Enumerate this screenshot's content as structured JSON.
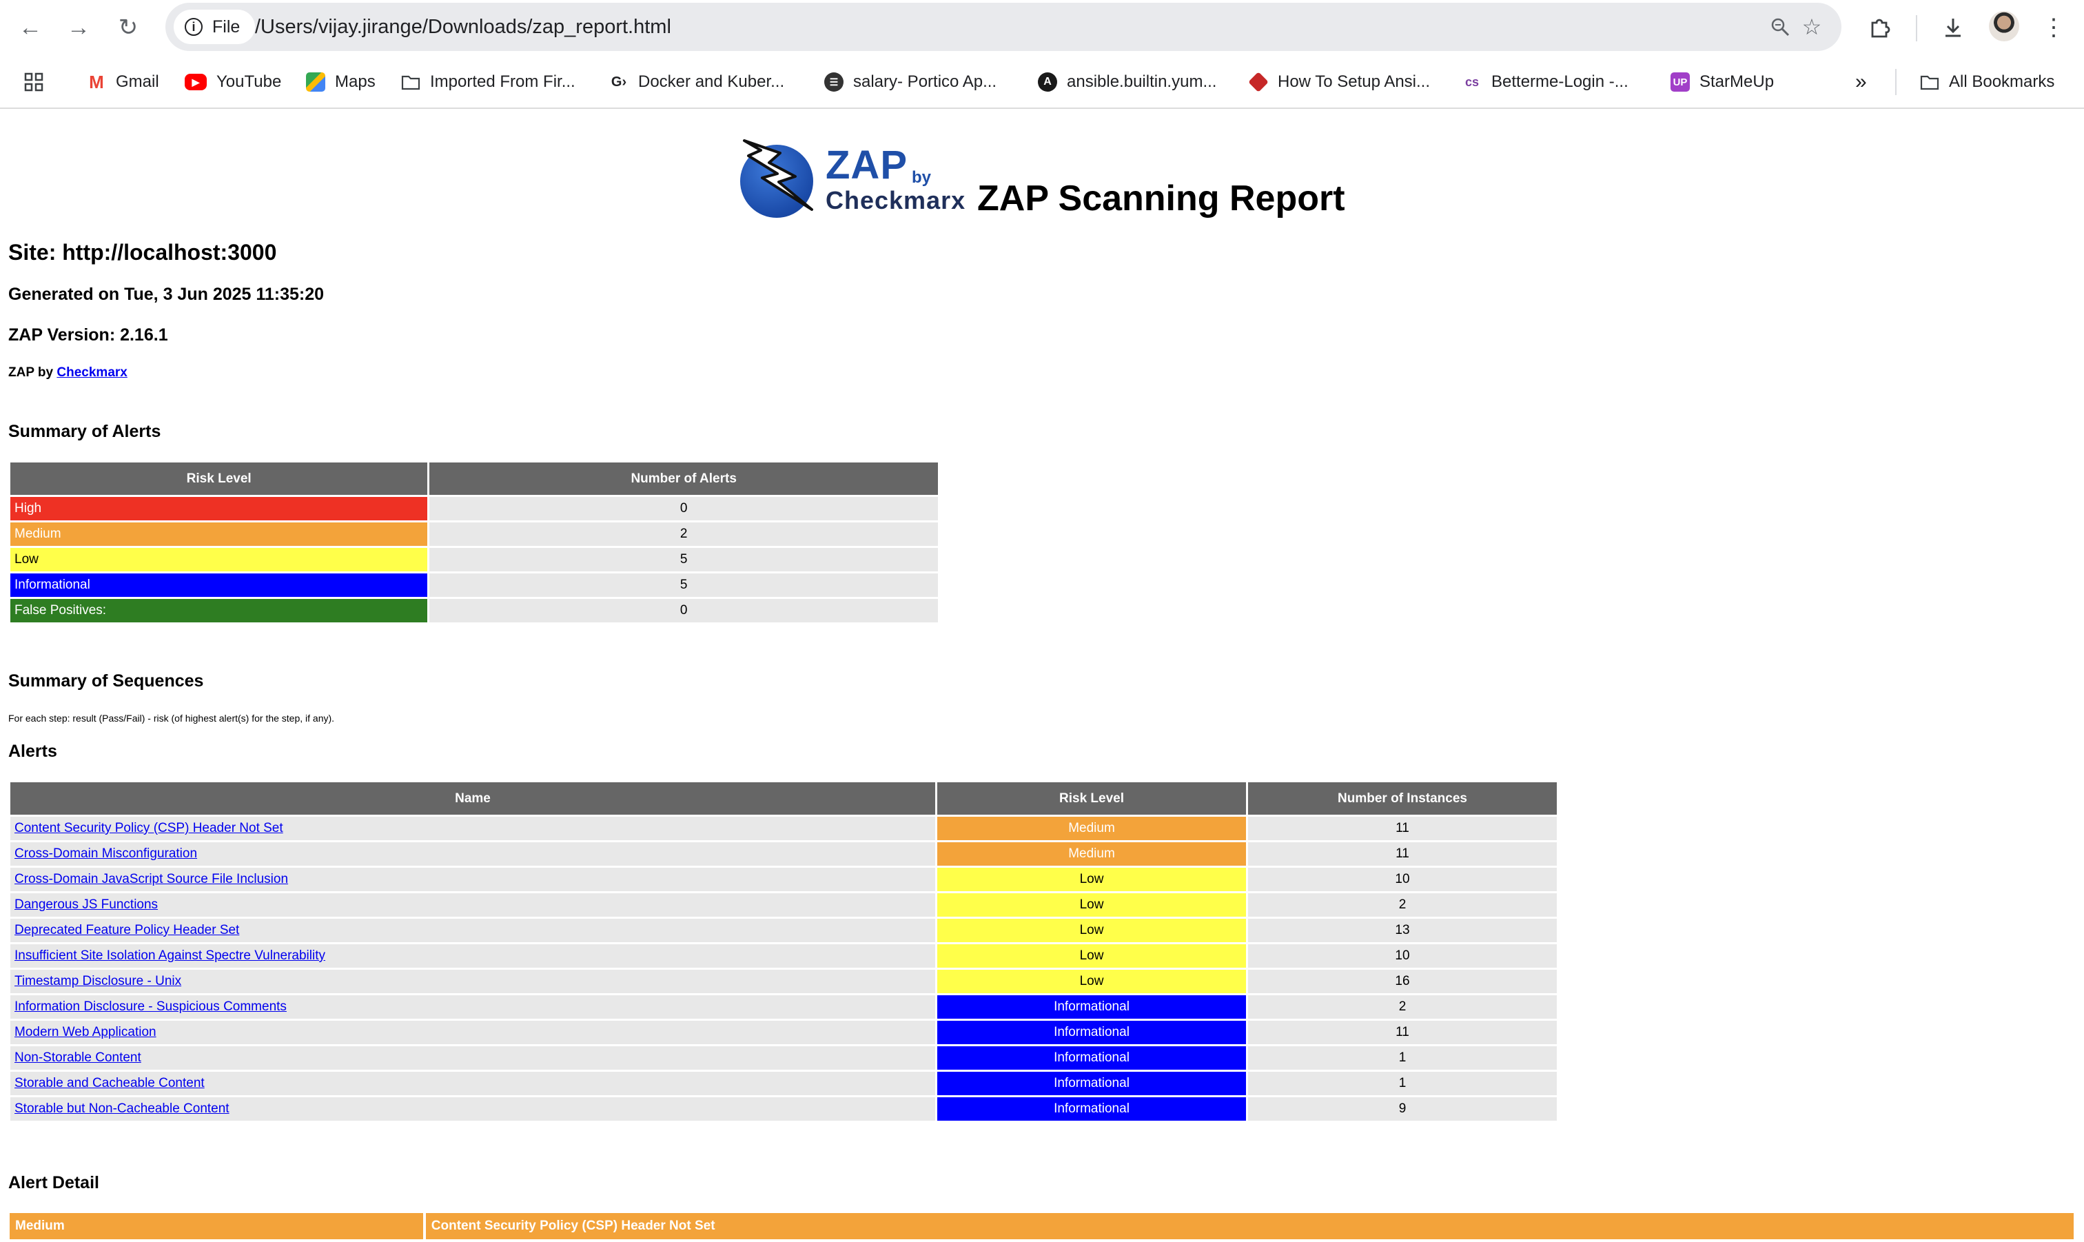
{
  "browser": {
    "file_chip": "File",
    "url": "/Users/vijay.jirange/Downloads/zap_report.html",
    "bookmarks": [
      {
        "label": "Gmail",
        "icon": "gmail-icon"
      },
      {
        "label": "YouTube",
        "icon": "youtube-icon"
      },
      {
        "label": "Maps",
        "icon": "maps-icon"
      },
      {
        "label": "Imported From Fir...",
        "icon": "folder-icon"
      },
      {
        "label": "Docker and Kuber...",
        "icon": "g-icon"
      },
      {
        "label": "salary- Portico Ap...",
        "icon": "portico-icon"
      },
      {
        "label": "ansible.builtin.yum...",
        "icon": "ansible-icon"
      },
      {
        "label": "How To Setup Ansi...",
        "icon": "cube-icon"
      },
      {
        "label": "Betterme-Login -...",
        "icon": "cs-icon"
      },
      {
        "label": "StarMeUp",
        "icon": "starmeup-icon"
      }
    ],
    "all_bookmarks": "All Bookmarks",
    "overflow": "»"
  },
  "report": {
    "logo_zap": "ZAP",
    "logo_by": "by",
    "logo_checkmarx": "Checkmarx",
    "title": "ZAP Scanning Report",
    "site": "Site: http://localhost:3000",
    "generated": "Generated on Tue, 3 Jun 2025 11:35:20",
    "version": "ZAP Version: 2.16.1",
    "by_prefix": "ZAP by ",
    "by_link": "Checkmarx"
  },
  "summary_alerts": {
    "heading": "Summary of Alerts",
    "col_risk": "Risk Level",
    "col_count": "Number of Alerts",
    "rows": [
      {
        "risk": "High",
        "count": "0"
      },
      {
        "risk": "Medium",
        "count": "2"
      },
      {
        "risk": "Low",
        "count": "5"
      },
      {
        "risk": "Informational",
        "count": "5"
      },
      {
        "risk": "False Positives:",
        "count": "0"
      }
    ]
  },
  "summary_sequences": {
    "heading": "Summary of Sequences",
    "note": "For each step: result (Pass/Fail) - risk (of highest alert(s) for the step, if any)."
  },
  "alerts": {
    "heading": "Alerts",
    "col_name": "Name",
    "col_risk": "Risk Level",
    "col_instances": "Number of Instances",
    "rows": [
      {
        "name": "Content Security Policy (CSP) Header Not Set",
        "risk": "Medium",
        "instances": "11"
      },
      {
        "name": "Cross-Domain Misconfiguration",
        "risk": "Medium",
        "instances": "11"
      },
      {
        "name": "Cross-Domain JavaScript Source File Inclusion",
        "risk": "Low",
        "instances": "10"
      },
      {
        "name": "Dangerous JS Functions",
        "risk": "Low",
        "instances": "2"
      },
      {
        "name": "Deprecated Feature Policy Header Set",
        "risk": "Low",
        "instances": "13"
      },
      {
        "name": "Insufficient Site Isolation Against Spectre Vulnerability",
        "risk": "Low",
        "instances": "10"
      },
      {
        "name": "Timestamp Disclosure - Unix",
        "risk": "Low",
        "instances": "16"
      },
      {
        "name": "Information Disclosure - Suspicious Comments",
        "risk": "Informational",
        "instances": "2"
      },
      {
        "name": "Modern Web Application",
        "risk": "Informational",
        "instances": "11"
      },
      {
        "name": "Non-Storable Content",
        "risk": "Informational",
        "instances": "1"
      },
      {
        "name": "Storable and Cacheable Content",
        "risk": "Informational",
        "instances": "1"
      },
      {
        "name": "Storable but Non-Cacheable Content",
        "risk": "Informational",
        "instances": "9"
      }
    ]
  },
  "alert_detail": {
    "heading": "Alert Detail",
    "risk": "Medium",
    "name": "Content Security Policy (CSP) Header Not Set"
  },
  "colors": {
    "high": "#ee3124",
    "medium": "#f3a33a",
    "low": "#ffff4a",
    "informational": "#0000ff",
    "false_positive": "#2e7d22",
    "header": "#666666"
  }
}
